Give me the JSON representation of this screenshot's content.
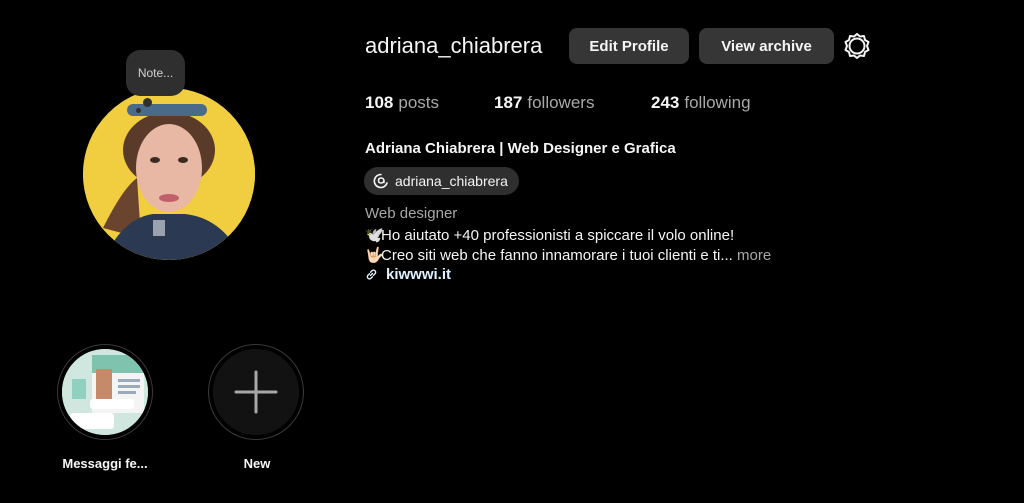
{
  "profile": {
    "username": "adriana_chiabrera",
    "note_placeholder": "Note...",
    "buttons": {
      "edit": "Edit Profile",
      "archive": "View archive"
    },
    "stats": {
      "posts_count": "108",
      "posts_label": "posts",
      "followers_count": "187",
      "followers_label": "followers",
      "following_count": "243",
      "following_label": "following"
    },
    "full_name": "Adriana Chiabrera | Web Designer e Grafica",
    "threads_handle": "adriana_chiabrera",
    "category": "Web designer",
    "bio_line1": "Ho aiutato +40 professionisti a spiccare il volo online!",
    "bio_line2": "Creo siti web che fanno innamorare i tuoi clienti e ti...",
    "bio_emoji1": "🕊️",
    "bio_emoji2": "🤟🏻",
    "more_label": "more",
    "website": "kiwwwi.it"
  },
  "highlights": [
    {
      "label": "Messaggi fe...",
      "icon": "highlight-cover"
    },
    {
      "label": "New",
      "icon": "plus-icon"
    }
  ],
  "colors": {
    "background": "#000000",
    "button_bg": "#363636",
    "muted_text": "#a8a8a8",
    "avatar_bg": "#f1cd40",
    "link_text": "#e0f1ff"
  }
}
